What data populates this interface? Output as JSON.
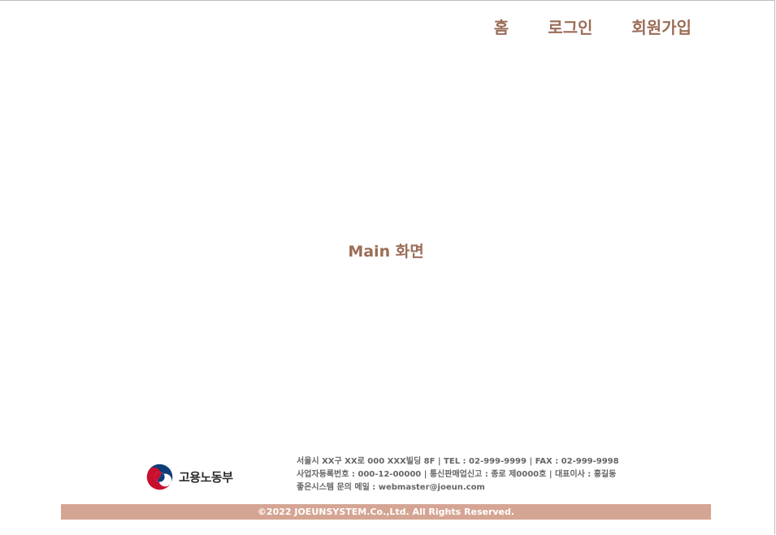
{
  "nav": {
    "home_label": "홈",
    "login_label": "로그인",
    "signup_label": "회원가입"
  },
  "main": {
    "title": "Main 화면"
  },
  "footer": {
    "logo_text": "고용노동부",
    "info_lines": [
      "서울시 XX구 XX로 000 XXX빌딩 8F | TEL : 02-999-9999 | FAX : 02-999-9998",
      "사업자등록번호 : 000-12-00000 | 통신판매업신고 : 종로 제0000호 | 대표이사 : 홍길동",
      "좋은시스템 문의 메일 : webmaster@joeun.com"
    ],
    "copyright": "©2022 JOEUNSYSTEM.Co.,Ltd. All Rights Reserved."
  },
  "colors": {
    "accent_text": "#9b6d58",
    "copyright_bar": "#d5a594",
    "logo_red": "#c8102e",
    "logo_blue": "#0f3d7a"
  }
}
